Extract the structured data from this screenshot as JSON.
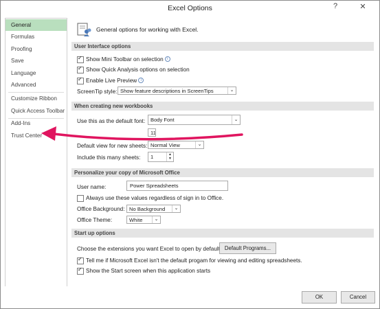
{
  "window": {
    "title": "Excel Options",
    "help_glyph": "?",
    "close_glyph": "✕"
  },
  "sidebar": {
    "items": [
      {
        "label": "General"
      },
      {
        "label": "Formulas"
      },
      {
        "label": "Proofing"
      },
      {
        "label": "Save"
      },
      {
        "label": "Language"
      },
      {
        "label": "Advanced"
      },
      {
        "label": "Customize Ribbon"
      },
      {
        "label": "Quick Access Toolbar"
      },
      {
        "label": "Add-Ins"
      },
      {
        "label": "Trust Center"
      }
    ]
  },
  "header": {
    "text": "General options for working with Excel."
  },
  "ui_options": {
    "title": "User Interface options",
    "mini_toolbar": "Show Mini Toolbar on selection",
    "quick_analysis": "Show Quick Analysis options on selection",
    "live_preview": "Enable Live Preview",
    "screentip_label": "ScreenTip style:",
    "screentip_value": "Show feature descriptions in ScreenTips"
  },
  "new_workbooks": {
    "title": "When creating new workbooks",
    "font_label": "Use this as the default font:",
    "font_value": "Body Font",
    "font_size_value": "11",
    "view_label": "Default view for new sheets:",
    "view_value": "Normal View",
    "sheets_label": "Include this many sheets:",
    "sheets_value": "1"
  },
  "personalize": {
    "title": "Personalize your copy of Microsoft Office",
    "username_label": "User name:",
    "username_value": "Power Spreadsheets",
    "always_use": "Always use these values regardless of sign in to Office.",
    "background_label": "Office Background:",
    "background_value": "No Background",
    "theme_label": "Office Theme:",
    "theme_value": "White"
  },
  "startup": {
    "title": "Start up options",
    "extensions_label": "Choose the extensions you want Excel to open by default:",
    "default_programs": "Default Programs...",
    "tell_me": "Tell me if Microsoft Excel isn't the default progam for viewing and editing spreadsheets.",
    "show_start": "Show the Start screen when this application starts"
  },
  "footer": {
    "ok": "OK",
    "cancel": "Cancel"
  },
  "annotation": {
    "arrow_color": "#e0155f"
  }
}
